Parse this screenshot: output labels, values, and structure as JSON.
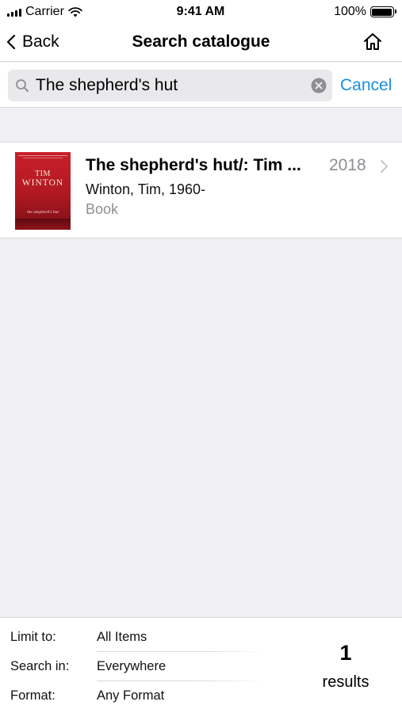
{
  "status_bar": {
    "carrier": "Carrier",
    "time": "9:41 AM",
    "battery": "100%"
  },
  "nav": {
    "back_label": "Back",
    "title": "Search catalogue",
    "home_icon": "home-icon"
  },
  "search": {
    "value": "The shepherd's hut",
    "cancel_label": "Cancel"
  },
  "results": [
    {
      "title": "The shepherd's hut/: Tim ...",
      "year": "2018",
      "author": "Winton, Tim, 1960-",
      "format": "Book",
      "cover": {
        "author_first": "TIM",
        "author_last": "WINTON",
        "title": "the shepherd's hut"
      }
    }
  ],
  "filters": {
    "limit_label": "Limit to:",
    "limit_value": "All Items",
    "search_in_label": "Search in:",
    "search_in_value": "Everywhere",
    "format_label": "Format:",
    "format_value": "Any Format"
  },
  "summary": {
    "count": "1",
    "label": "results"
  },
  "colors": {
    "accent": "#1a8fe3",
    "background": "#efeff4",
    "secondary_text": "#8e8e93"
  }
}
